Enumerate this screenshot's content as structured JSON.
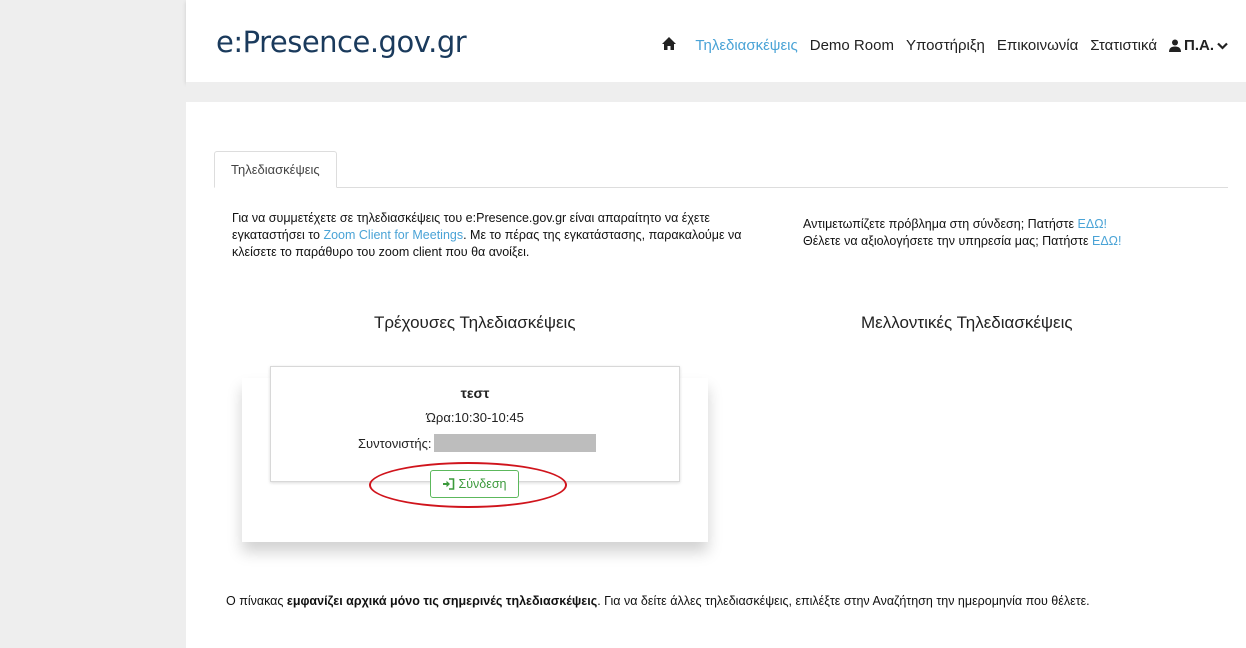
{
  "header": {
    "brand": "e:Presence.gov.gr",
    "nav": [
      {
        "label": "Τηλεδιασκέψεις",
        "active": true
      },
      {
        "label": "Demo Room",
        "active": false
      },
      {
        "label": "Υποστήριξη",
        "active": false
      },
      {
        "label": "Επικοινωνία",
        "active": false
      },
      {
        "label": "Στατιστικά",
        "active": false
      }
    ],
    "user": "Π.Α.",
    "icons": {
      "home": "home-icon",
      "user": "user-icon",
      "caret": "chevron-down-icon"
    }
  },
  "tab": {
    "label": "Τηλεδιασκέψεις"
  },
  "intro": {
    "text_before": "Για να συμμετέχετε σε τηλεδιασκέψεις του e:Presence.gov.gr είναι απαραίτητο να έχετε εγκαταστήσει το ",
    "link": "Zoom Client for Meetings",
    "text_after": ". Με το πέρας της εγκατάστασης, παρακαλούμε να κλείσετε το παράθυρο του zoom client που θα ανοίξει."
  },
  "help": {
    "line1": "Αντιμετωπίζετε πρόβλημα στη σύνδεση; Πατήστε ",
    "line1_link": "ΕΔΩ!",
    "line2": "Θέλετε να αξιολογήσετε την υπηρεσία μας; Πατήστε ",
    "line2_link": "ΕΔΩ!"
  },
  "columns": {
    "current": "Τρέχουσες Τηλεδιασκέψεις",
    "future": "Μελλοντικές Τηλεδιασκέψεις"
  },
  "meeting": {
    "title": "τεστ",
    "time": "Ώρα:10:30-10:45",
    "host_label": "Συντονιστής:",
    "join": "Σύνδεση"
  },
  "footer": {
    "before": "Ο πίνακας ",
    "bold": "εμφανίζει αρχικά μόνο τις σημερινές τηλεδιασκέψεις",
    "after": ". Για να δείτε άλλες τηλεδιασκέψεις, επιλέξτε στην Αναζήτηση την ημερομηνία που θέλετε."
  },
  "colors": {
    "accent": "#4aa3d6",
    "join": "#5cb85c",
    "highlight": "#d0141c"
  }
}
